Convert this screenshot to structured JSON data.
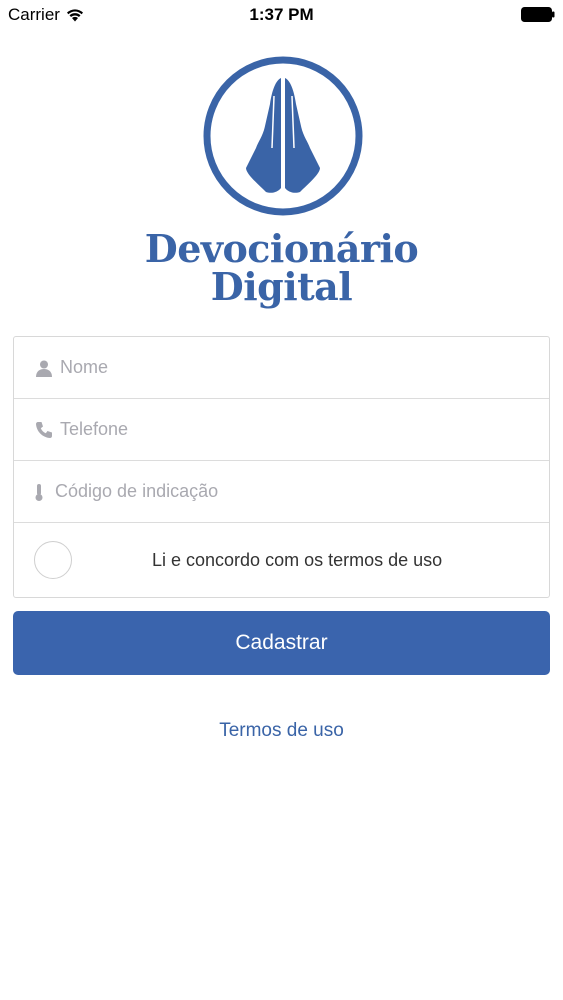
{
  "status_bar": {
    "carrier": "Carrier",
    "time": "1:37 PM"
  },
  "logo": {
    "line1": "Devocionário",
    "line2": "Digital",
    "icon": "praying-hands-icon",
    "color": "#3a64a7"
  },
  "form": {
    "name": {
      "placeholder": "Nome",
      "icon": "person-icon"
    },
    "phone": {
      "placeholder": "Telefone",
      "icon": "phone-icon"
    },
    "referral": {
      "placeholder": "Código de indicação",
      "icon": "thermometer-icon"
    },
    "agree_label": "Li e concordo com os termos de uso"
  },
  "submit_label": "Cadastrar",
  "terms_link": "Termos de uso",
  "colors": {
    "accent": "#3a64ad",
    "placeholder": "#a9a9b0"
  }
}
